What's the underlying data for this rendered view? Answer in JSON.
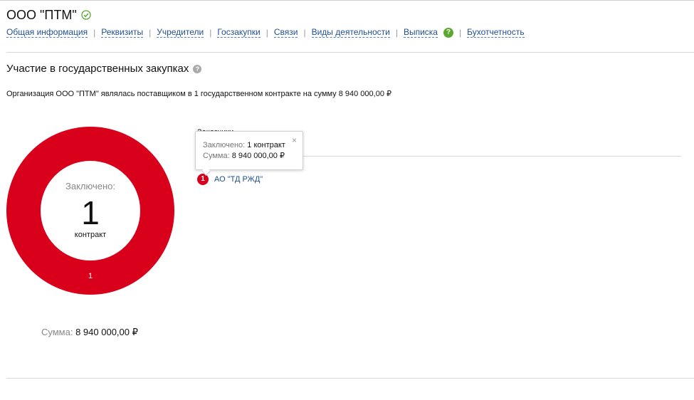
{
  "company": {
    "title": "ООО \"ПТМ\"",
    "verified_color": "#5aa82e"
  },
  "nav": {
    "items": [
      {
        "label": "Общая информация"
      },
      {
        "label": "Реквизиты"
      },
      {
        "label": "Учредители"
      },
      {
        "label": "Госзакупки"
      },
      {
        "label": "Связи"
      },
      {
        "label": "Виды деятельности"
      },
      {
        "label": "Выписка"
      },
      {
        "label": "Бухотчетность"
      }
    ],
    "help_glyph": "?"
  },
  "section": {
    "title": "Участие в государственных закупках",
    "help_glyph": "?",
    "summary": "Организация ООО \"ПТМ\" являлась поставщиком в 1 государственном контракте на сумму 8 940 000,00 ₽"
  },
  "chart_data": {
    "type": "pie",
    "donut": true,
    "categories": [
      "АО \"ТД РЖД\""
    ],
    "values": [
      1
    ],
    "slice_labels": [
      "1"
    ],
    "colors": [
      "#d9001b"
    ],
    "center": {
      "label": "Заключено:",
      "value": "1",
      "unit": "контракт"
    },
    "sum": {
      "label": "Сумма:",
      "value": "8 940 000,00 ₽"
    }
  },
  "customers": {
    "header": "Заказчики",
    "items": [
      {
        "badge": "1",
        "name": "АО \"ТД РЖД\""
      }
    ]
  },
  "tooltip": {
    "line1_label": "Заключено:",
    "line1_value": "1 контракт",
    "line2_label": "Сумма:",
    "line2_value": "8 940 000,00 ₽",
    "close": "×"
  }
}
